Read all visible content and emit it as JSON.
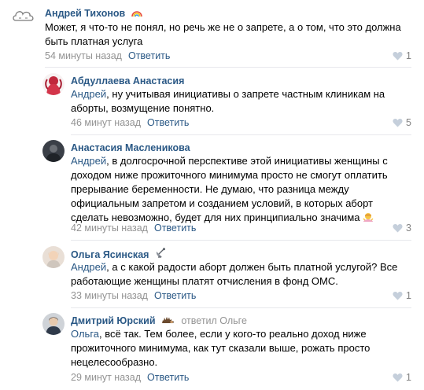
{
  "comments": [
    {
      "author": "Андрей Тихонов",
      "badge_icon": "rainbow-icon",
      "text": "Может, я что-то не понял, но речь же не о запрете, а о том, что это должна быть платная услуга",
      "time": "54 минуты назад",
      "reply_label": "Ответить",
      "likes": "1"
    },
    {
      "author": "Абдуллаева Анастасия",
      "mention": "Андрей",
      "text": ", ну учитывая инициативы о запрете частным клиникам на аборты, возмущение понятно.",
      "time": "46 минут назад",
      "reply_label": "Ответить",
      "likes": "5"
    },
    {
      "author": "Анастасия Масленикова",
      "mention": "Андрей",
      "text": ", в долгосрочной перспективе этой инициативы женщины с доходом ниже прожиточного минимума просто не смогут оплатить прерывание беременности. Не думаю, что разница между официальным запретом и созданием условий, в которых аборт сделать невозможно, будет для них принципиально значима",
      "emoji_icon": "woman-shrugging-emoji",
      "time": "42 минуты назад",
      "reply_label": "Ответить",
      "likes": "3"
    },
    {
      "author": "Ольга Ясинская",
      "badge_icon": "satellite-antenna-icon",
      "mention": "Андрей",
      "text": ", а с какой радости аборт должен быть платной услугой? Все работающие женщины платят отчисления в фонд ОМС.",
      "time": "33 минуты назад",
      "reply_label": "Ответить",
      "likes": "1"
    },
    {
      "author": "Дмитрий Юрский",
      "badge_icon": "hedgehog-icon",
      "replied_to": "ответил Ольге",
      "mention": "Ольга",
      "text": ", всё так. Тем более, если у кого-то реально доход ниже прожиточного минимума, как тут сказали выше, рожать просто нецелесообразно.",
      "time": "29 минут назад",
      "reply_label": "Ответить",
      "likes": "1"
    }
  ],
  "colors": {
    "link": "#2a5885",
    "meta": "#939393",
    "separator": "#e7e8ec"
  }
}
